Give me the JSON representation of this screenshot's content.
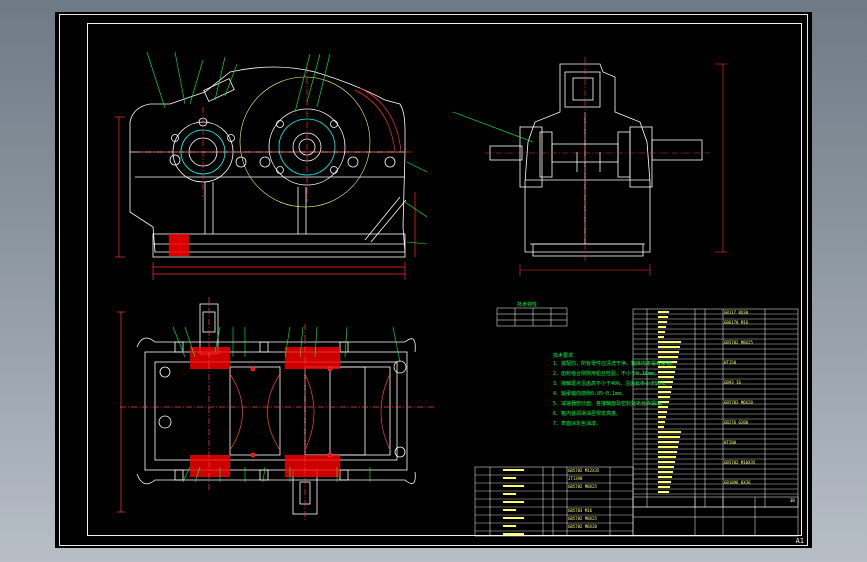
{
  "sheet_size_label": "A1",
  "title_block_code": "3B",
  "colors": {
    "background": "#000000",
    "frame": "#ffffff",
    "outline": "#ffffff",
    "center_line": "#ff3030",
    "leader": "#00ff40",
    "section_fill": "#ff0000",
    "hatch": "#ff4040",
    "dimension": "#ff3030",
    "bearing": "#00ffff",
    "text": "#ffff66",
    "notes": "#00ff40",
    "gear": "#ffff80"
  },
  "notes": {
    "title": "技术要求",
    "items": [
      "1、装配前，所有零件应清洗干净，箱体内不得有杂物。",
      "2、齿轮啮合侧隙用铅丝检验，不小于0.16mm。",
      "3、接触斑点沿齿高不小于40%，沿齿长不小于50%。",
      "4、轴承轴向游隙0.05~0.1mm。",
      "5、减速器剖分面、各接触面及密封处不允许漏油。",
      "6、箱内装润滑油至规定高度。",
      "7、表面涂灰色油漆。"
    ]
  },
  "spec_table": {
    "title": "技术特性"
  },
  "parts_list_lower": {
    "std_codes": [
      "GB5782  M12X35",
      "JT1390",
      "GB5782  M8X25",
      "45",
      "Q235",
      "GB5783  M16",
      "GB5782  M8X25",
      "45",
      "GB5782  M6X20"
    ]
  },
  "parts_list_right": {
    "std_codes": [
      "GB117  8X30",
      "Q235",
      "GB6170  M16",
      "45",
      "GB5782  M8X25",
      "HT150",
      "Q235",
      "GB93  16",
      "HT150",
      "45",
      "GB5783  M6X20",
      "Q235",
      "GB276  6208",
      "HT200",
      "45",
      "GB5782  M10X35",
      "HT150",
      "Q235",
      "GB1096  8X36"
    ]
  }
}
